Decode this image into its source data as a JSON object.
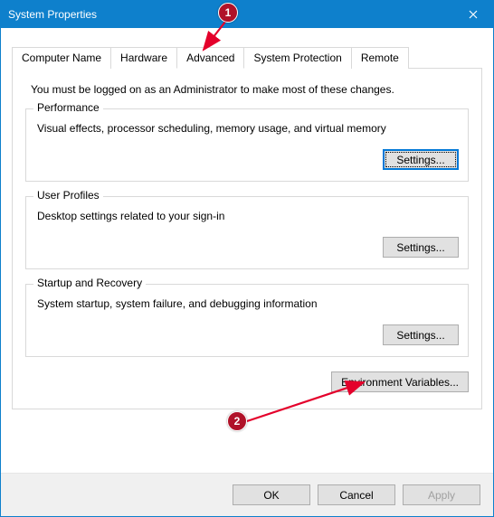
{
  "window": {
    "title": "System Properties"
  },
  "tabs": {
    "computer_name": "Computer Name",
    "hardware": "Hardware",
    "advanced": "Advanced",
    "system_protection": "System Protection",
    "remote": "Remote",
    "active": "advanced"
  },
  "intro": "You must be logged on as an Administrator to make most of these changes.",
  "performance": {
    "title": "Performance",
    "desc": "Visual effects, processor scheduling, memory usage, and virtual memory",
    "button": "Settings..."
  },
  "user_profiles": {
    "title": "User Profiles",
    "desc": "Desktop settings related to your sign-in",
    "button": "Settings..."
  },
  "startup_recovery": {
    "title": "Startup and Recovery",
    "desc": "System startup, system failure, and debugging information",
    "button": "Settings..."
  },
  "env_button": "Environment Variables...",
  "dialog": {
    "ok": "OK",
    "cancel": "Cancel",
    "apply": "Apply"
  },
  "annotations": {
    "badge1": "1",
    "badge2": "2",
    "color": "#b01229"
  }
}
